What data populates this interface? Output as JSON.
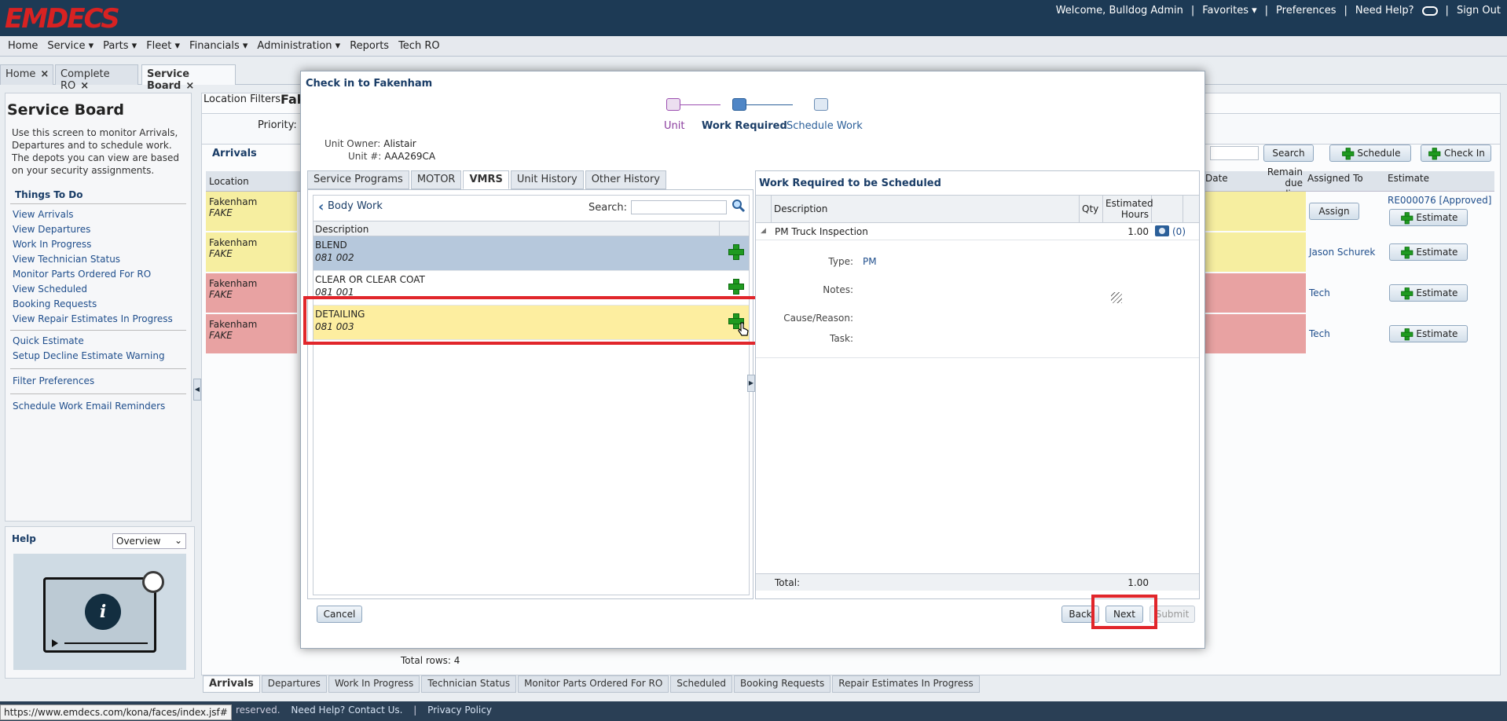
{
  "app": {
    "logo": "EMDECS",
    "top_nav": [
      "Welcome, Bulldog Admin",
      "|",
      "Favorites ▾",
      "|",
      "Preferences",
      "|",
      "Need Help?",
      "|",
      "Sign Out"
    ],
    "menu": [
      "Home",
      "Service ▾",
      "Parts ▾",
      "Fleet ▾",
      "Financials ▾",
      "Administration ▾",
      "Reports",
      "Tech RO"
    ],
    "tabs": [
      {
        "label": "Home",
        "close": "×"
      },
      {
        "label": "Complete RO",
        "close": "×"
      },
      {
        "label": "Service Board",
        "close": "×"
      }
    ]
  },
  "sidebar": {
    "title": "Service Board",
    "description": "Use this screen to monitor Arrivals, Departures and to schedule work. The depots you can view are based on your security assignments.",
    "things_title": "Things To Do",
    "links": [
      "View Arrivals",
      "View Departures",
      "Work In Progress",
      "View Technician Status",
      "Monitor Parts Ordered For RO",
      "View Scheduled",
      "Booking Requests",
      "View Repair Estimates In Progress"
    ],
    "links2": [
      "Quick Estimate",
      "Setup Decline Estimate Warning"
    ],
    "links3": [
      "Filter Preferences"
    ],
    "links4": [
      "Schedule Work Email Reminders"
    ],
    "help_title": "Help",
    "help_select": "Overview"
  },
  "background": {
    "location_filters": "Location Filters:",
    "location_value": "Fak",
    "priority": "Priority:",
    "section": "Arrivals",
    "search_btn": "Search",
    "schedule_btn": "Schedule",
    "checkin_btn": "Check In",
    "headers": {
      "location": "Location",
      "date": "Date",
      "remain": "Remain due reading",
      "assigned": "Assigned To",
      "estimate": "Estimate"
    },
    "rows": [
      {
        "location": "Fakenham",
        "code": "FAKE",
        "assigned": "Assign",
        "estimate": "RE000076 [Approved]",
        "estimate_btn": "Estimate",
        "color": "#f6eea0"
      },
      {
        "location": "Fakenham",
        "code": "FAKE",
        "assigned": "Jason Schurek",
        "estimate_btn": "Estimate",
        "color": "#f6eea0"
      },
      {
        "location": "Fakenham",
        "code": "FAKE",
        "assigned": "Tech",
        "estimate_btn": "Estimate",
        "color": "#e8a2a2"
      },
      {
        "location": "Fakenham",
        "code": "FAKE",
        "assigned": "Tech",
        "estimate_btn": "Estimate",
        "color": "#e8a2a2"
      }
    ],
    "total_rows": "Total rows:  4",
    "bottom_tabs": [
      "Arrivals",
      "Departures",
      "Work In Progress",
      "Technician Status",
      "Monitor Parts Ordered For RO",
      "Scheduled",
      "Booking Requests",
      "Repair Estimates In Progress"
    ]
  },
  "footer": {
    "rights": "reserved.",
    "help": "Need Help? Contact Us.",
    "sep": "|",
    "privacy": "Privacy Policy",
    "status_url": "https://www.emdecs.com/kona/faces/index.jsf#"
  },
  "modal": {
    "title": "Check in to Fakenham",
    "train": [
      "Unit",
      "Work Required",
      "Schedule Work"
    ],
    "owner_label": "Unit Owner:",
    "owner_value": "Alistair",
    "unit_label": "Unit #:",
    "unit_value": "AAA269CA",
    "subtabs": [
      "Service Programs",
      "MOTOR",
      "VMRS",
      "Unit History",
      "Other History"
    ],
    "breadcrumb": "Body Work",
    "search_label": "Search:",
    "desc_header": "Description",
    "vmrs_rows": [
      {
        "name": "BLEND",
        "code": "081 002"
      },
      {
        "name": "CLEAR OR CLEAR COAT",
        "code": "081 001"
      },
      {
        "name": "DETAILING",
        "code": "081 003"
      }
    ],
    "work": {
      "title": "Work Required to be Scheduled",
      "headers": {
        "description": "Description",
        "qty": "Qty",
        "hours": "Estimated Hours"
      },
      "item": {
        "description": "PM Truck Inspection",
        "hours": "1.00",
        "attach": "(0)"
      },
      "type_label": "Type:",
      "type_value": "PM",
      "notes_label": "Notes:",
      "cause_label": "Cause/Reason:",
      "task_label": "Task:",
      "total_label": "Total:",
      "total_value": "1.00"
    },
    "buttons": {
      "cancel": "Cancel",
      "back": "Back",
      "next": "Next",
      "submit": "Submit"
    }
  }
}
